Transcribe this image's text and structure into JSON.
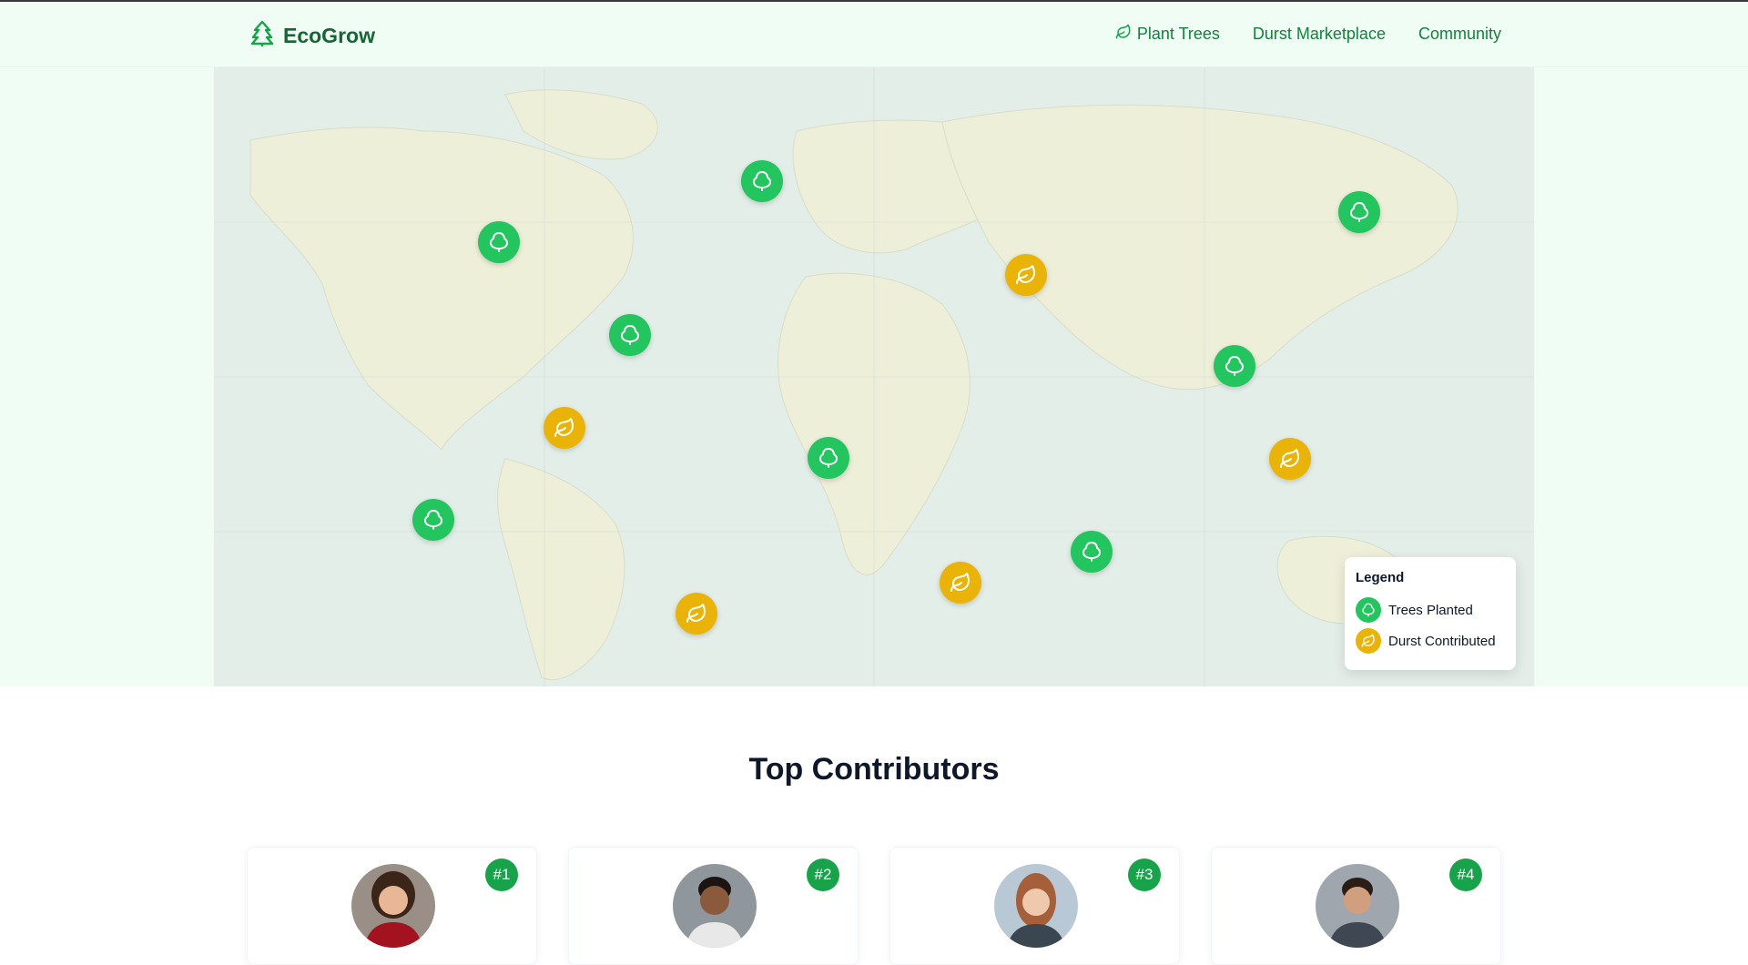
{
  "brand": {
    "name": "EcoGrow",
    "icon": "pine-tree-icon"
  },
  "nav": {
    "items": [
      {
        "label": "Plant Trees",
        "icon": "leaf-icon"
      },
      {
        "label": "Durst Marketplace"
      },
      {
        "label": "Community"
      }
    ]
  },
  "map": {
    "markers": [
      {
        "type": "trees-planted",
        "icon": "tree-icon"
      },
      {
        "type": "trees-planted",
        "icon": "tree-icon"
      },
      {
        "type": "trees-planted",
        "icon": "tree-icon"
      },
      {
        "type": "trees-planted",
        "icon": "tree-icon"
      },
      {
        "type": "trees-planted",
        "icon": "tree-icon"
      },
      {
        "type": "trees-planted",
        "icon": "tree-icon"
      },
      {
        "type": "trees-planted",
        "icon": "tree-icon"
      },
      {
        "type": "trees-planted",
        "icon": "tree-icon"
      },
      {
        "type": "durst-contributed",
        "icon": "leaf-icon"
      },
      {
        "type": "durst-contributed",
        "icon": "leaf-icon"
      },
      {
        "type": "durst-contributed",
        "icon": "leaf-icon"
      },
      {
        "type": "durst-contributed",
        "icon": "leaf-icon"
      },
      {
        "type": "durst-contributed",
        "icon": "leaf-icon"
      },
      {
        "type": "durst-contributed",
        "icon": "leaf-icon"
      }
    ],
    "legend": {
      "title": "Legend",
      "items": [
        {
          "label": "Trees Planted",
          "icon": "tree-icon",
          "color": "#22c55e"
        },
        {
          "label": "Durst Contributed",
          "icon": "leaf-icon",
          "color": "#eab308"
        }
      ]
    }
  },
  "contributors": {
    "title": "Top Contributors",
    "items": [
      {
        "rank": "#1"
      },
      {
        "rank": "#2"
      },
      {
        "rank": "#3"
      },
      {
        "rank": "#4"
      }
    ]
  },
  "colors": {
    "brand": "#166534",
    "accent": "#22c55e",
    "durst": "#eab308",
    "nav_bg": "#f0fdf4"
  }
}
